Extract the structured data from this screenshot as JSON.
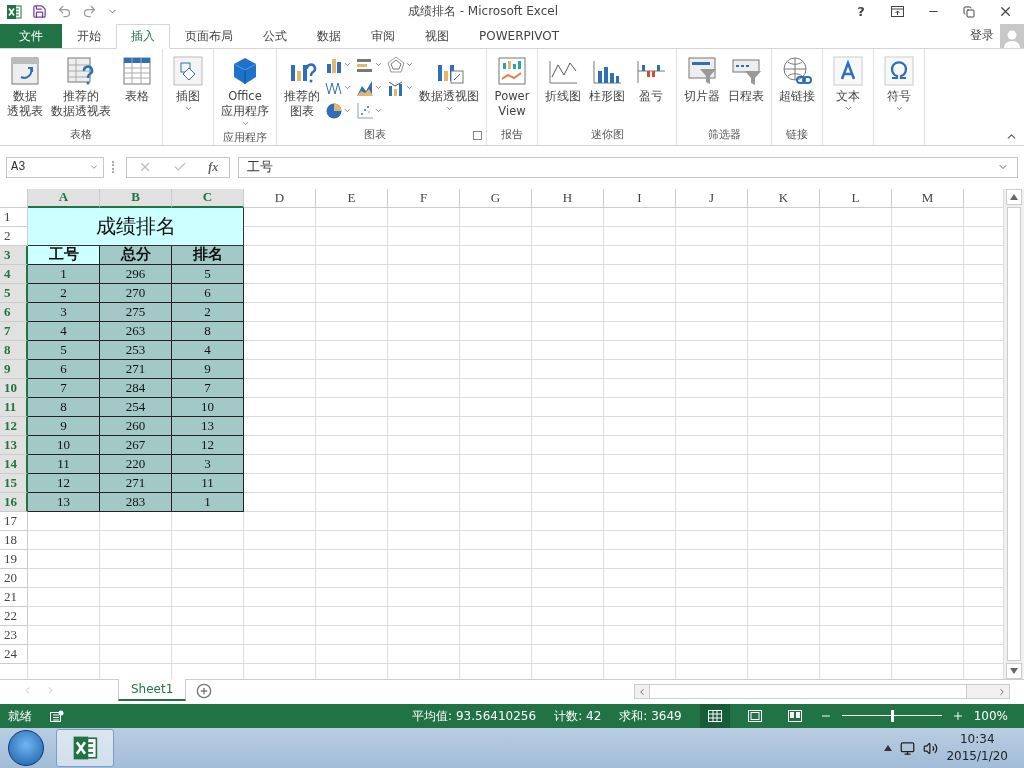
{
  "window": {
    "title": "成绩排名 - Microsoft Excel",
    "help": "?"
  },
  "tabs": [
    {
      "label": "文件",
      "kind": "file",
      "selected": false
    },
    {
      "label": "开始",
      "kind": "tab",
      "selected": false
    },
    {
      "label": "插入",
      "kind": "tab",
      "selected": true
    },
    {
      "label": "页面布局",
      "kind": "tab",
      "selected": false
    },
    {
      "label": "公式",
      "kind": "tab",
      "selected": false
    },
    {
      "label": "数据",
      "kind": "tab",
      "selected": false
    },
    {
      "label": "审阅",
      "kind": "tab",
      "selected": false
    },
    {
      "label": "视图",
      "kind": "tab",
      "selected": false
    },
    {
      "label": "POWERPIVOT",
      "kind": "tab",
      "selected": false
    }
  ],
  "account": {
    "sign_in": "登录"
  },
  "ribbon": {
    "groups": [
      {
        "label": "表格",
        "items": [
          {
            "kind": "large",
            "lines": [
              "数据",
              "透视表"
            ]
          },
          {
            "kind": "large",
            "lines": [
              "推荐的",
              "数据透视表"
            ]
          },
          {
            "kind": "large",
            "lines": [
              "表格"
            ]
          }
        ]
      },
      {
        "items": [
          {
            "kind": "large",
            "lines": [
              "插图"
            ],
            "dropdown": true
          }
        ]
      },
      {
        "label": "应用程序",
        "items": [
          {
            "kind": "large",
            "lines": [
              "Office",
              "应用程序"
            ],
            "dropdown": true
          }
        ]
      },
      {
        "label": "图表",
        "launcher": true,
        "items": [
          {
            "kind": "large",
            "lines": [
              "推荐的",
              "图表"
            ]
          },
          {
            "kind": "small",
            "dropdown": true
          },
          {
            "kind": "small",
            "dropdown": true
          },
          {
            "kind": "small",
            "dropdown": true
          },
          {
            "kind": "small",
            "dropdown": true
          },
          {
            "kind": "small",
            "dropdown": true
          },
          {
            "kind": "small",
            "dropdown": true
          },
          {
            "kind": "small",
            "dropdown": true
          },
          {
            "kind": "small",
            "dropdown": true
          },
          {
            "kind": "large",
            "lines": [
              "数据透视图"
            ],
            "dropdown": true
          }
        ]
      },
      {
        "label": "报告",
        "items": [
          {
            "kind": "large",
            "lines": [
              "Power",
              "View"
            ]
          }
        ]
      },
      {
        "label": "迷你图",
        "items": [
          {
            "kind": "large",
            "lines": [
              "折线图"
            ]
          },
          {
            "kind": "large",
            "lines": [
              "柱形图"
            ]
          },
          {
            "kind": "large",
            "lines": [
              "盈亏"
            ]
          }
        ]
      },
      {
        "label": "筛选器",
        "items": [
          {
            "kind": "large",
            "lines": [
              "切片器"
            ]
          },
          {
            "kind": "large",
            "lines": [
              "日程表"
            ]
          }
        ]
      },
      {
        "label": "链接",
        "items": [
          {
            "kind": "large",
            "lines": [
              "超链接"
            ]
          }
        ]
      },
      {
        "items": [
          {
            "kind": "large",
            "lines": [
              "文本"
            ],
            "dropdown": true
          }
        ]
      },
      {
        "items": [
          {
            "kind": "large",
            "lines": [
              "符号"
            ],
            "dropdown": true
          }
        ]
      }
    ]
  },
  "formula_bar": {
    "name_box": "A3",
    "function_label": "fx",
    "value": "工号"
  },
  "sheet": {
    "columns": [
      {
        "label": "A",
        "selected": true
      },
      {
        "label": "B",
        "selected": true
      },
      {
        "label": "C",
        "selected": true
      },
      {
        "label": "D",
        "selected": false
      },
      {
        "label": "E",
        "selected": false
      },
      {
        "label": "F",
        "selected": false
      },
      {
        "label": "G",
        "selected": false
      },
      {
        "label": "H",
        "selected": false
      },
      {
        "label": "I",
        "selected": false
      },
      {
        "label": "J",
        "selected": false
      },
      {
        "label": "K",
        "selected": false
      },
      {
        "label": "L",
        "selected": false
      },
      {
        "label": "M",
        "selected": false
      }
    ],
    "rows": [
      {
        "label": "1",
        "selected": false
      },
      {
        "label": "2",
        "selected": false
      },
      {
        "label": "3",
        "selected": true
      },
      {
        "label": "4",
        "selected": true
      },
      {
        "label": "5",
        "selected": true
      },
      {
        "label": "6",
        "selected": true
      },
      {
        "label": "7",
        "selected": true
      },
      {
        "label": "8",
        "selected": true
      },
      {
        "label": "9",
        "selected": true
      },
      {
        "label": "10",
        "selected": true
      },
      {
        "label": "11",
        "selected": true
      },
      {
        "label": "12",
        "selected": true
      },
      {
        "label": "13",
        "selected": true
      },
      {
        "label": "14",
        "selected": true
      },
      {
        "label": "15",
        "selected": true
      },
      {
        "label": "16",
        "selected": true
      },
      {
        "label": "17",
        "selected": false
      },
      {
        "label": "18",
        "selected": false
      },
      {
        "label": "19",
        "selected": false
      },
      {
        "label": "20",
        "selected": false
      },
      {
        "label": "21",
        "selected": false
      },
      {
        "label": "22",
        "selected": false
      },
      {
        "label": "23",
        "selected": false
      },
      {
        "label": "24",
        "selected": false
      }
    ],
    "title": "成绩排名",
    "table": {
      "header": [
        {
          "text": "工号",
          "active": true
        },
        {
          "text": "总分",
          "active": false
        },
        {
          "text": "排名",
          "active": false
        }
      ],
      "rows": [
        [
          "1",
          "296",
          "5"
        ],
        [
          "2",
          "270",
          "6"
        ],
        [
          "3",
          "275",
          "2"
        ],
        [
          "4",
          "263",
          "8"
        ],
        [
          "5",
          "253",
          "4"
        ],
        [
          "6",
          "271",
          "9"
        ],
        [
          "7",
          "284",
          "7"
        ],
        [
          "8",
          "254",
          "10"
        ],
        [
          "9",
          "260",
          "13"
        ],
        [
          "10",
          "267",
          "12"
        ],
        [
          "11",
          "220",
          "3"
        ],
        [
          "12",
          "271",
          "11"
        ],
        [
          "13",
          "283",
          "1"
        ]
      ]
    }
  },
  "sheet_tabs": [
    {
      "label": "Sheet1",
      "selected": true
    }
  ],
  "status_bar": {
    "mode": "就绪",
    "stats": [
      "平均值: 93.56410256",
      "计数: 42",
      "求和: 3649"
    ],
    "views": [
      {
        "kind": "normal",
        "selected": true
      },
      {
        "kind": "page-layout",
        "selected": false
      },
      {
        "kind": "page-break",
        "selected": false
      }
    ],
    "zoom": {
      "level": 0.5,
      "label": "100%"
    }
  },
  "taskbar": {
    "time": "10:34",
    "date": "2015/1/20"
  }
}
